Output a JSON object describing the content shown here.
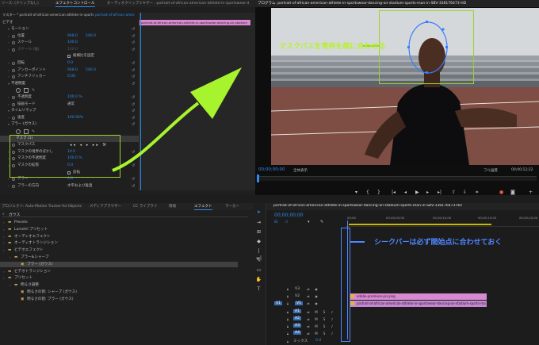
{
  "effect_controls": {
    "tabs": [
      "ソース: (クリップなし)",
      "エフェクトコントロール",
      "オーディオクリップミキサー : portrait-of-african-american-athlete-in-sportswear-d"
    ],
    "source_line": "マスター * portrait-of-african-american-athlete-in-sportswear-dancing-on-stadium",
    "sequence_line": "portrait-of-african-american-athle...",
    "clip_label": "portrait-of-african-american-athlete-in-sportswear-dancing-on-stadium",
    "section_video": "ビデオ",
    "rows": [
      {
        "label": "モーション",
        "type": "header"
      },
      {
        "label": "位置",
        "v1": "948.0",
        "v2": "540.0"
      },
      {
        "label": "スケール",
        "v1": "100.0"
      },
      {
        "label": "スケール (幅)",
        "v1": "100.0",
        "dim": true
      },
      {
        "label": "縦横比を固定",
        "type": "checkbox"
      },
      {
        "label": "回転",
        "v1": "0.0"
      },
      {
        "label": "アンカーポイント",
        "v1": "948.0",
        "v2": "540.0"
      },
      {
        "label": "アンチフリッカー",
        "v1": "0.00"
      },
      {
        "label": "不透明度",
        "type": "header"
      },
      {
        "label": "",
        "type": "mask-tools"
      },
      {
        "label": "不透明度",
        "v1": "100.0 %"
      },
      {
        "label": "描画モード",
        "v1": "通常",
        "plain": true
      },
      {
        "label": "タイムリマップ",
        "type": "header"
      },
      {
        "label": "速度",
        "v1": "100.00%"
      },
      {
        "label": "ブラー (ガウス)",
        "type": "header"
      },
      {
        "label": "",
        "type": "mask-tools"
      },
      {
        "label": "マスク (1)",
        "type": "subheader"
      },
      {
        "label": "マスクパス",
        "type": "maskpath"
      },
      {
        "label": "マスクの境界のぼかし",
        "v1": "10.0"
      },
      {
        "label": "マスクの不透明度",
        "v1": "100.0 %"
      },
      {
        "label": "マスクの拡張",
        "v1": "0.0"
      },
      {
        "label": "反転",
        "type": "checkbox"
      },
      {
        "label": "ブラー",
        "v1": "0.0"
      },
      {
        "label": "ブラーの方向",
        "v1": "水平および垂直",
        "plain": true
      }
    ]
  },
  "program_monitor": {
    "title": "プログラム: portrait-of-african-american-athlete-in-sportswear-dancing-on-stadium-sports-man-in-SBV-338176473-HD",
    "timecode": "00;00;00;00",
    "fit": "全体表示",
    "quality": "フル画質",
    "end_timecode": "00;00;12;22"
  },
  "timeline": {
    "title": "portrait-of-african-american-athlete-in-sportswear-dancing-on-stadium-sports-man-in-SBV-338176473-HD",
    "timecode": "00;00;00;00",
    "ruler": [
      "00;00",
      "00;00;05;00",
      "00;00;10;00",
      "00;00;15;00",
      "00;00;20;00"
    ],
    "video_tracks": [
      "V3",
      "V2",
      "V1"
    ],
    "audio_tracks": [
      "A1",
      "A2",
      "A3",
      "A4"
    ],
    "mix_label": "ミックス",
    "mix_value": "0.0",
    "clip_v2": "adobe-premiere-pro.png",
    "clip_v1": "portrait-of-african-american-athlete-in-sportswear-dancing-on-stadium-sports-man-in"
  },
  "project_panel": {
    "tabs": [
      "プロジェクト: Auto-Motion Tracker-for-Objects",
      "メディアブラウザー",
      "CC ライブラリ",
      "情報",
      "エフェクト",
      "マーカー"
    ],
    "search_value": "ガウス",
    "items": [
      {
        "label": "Presets",
        "indent": 0,
        "folder": true
      },
      {
        "label": "Lumetri プリセット",
        "indent": 0,
        "folder": true
      },
      {
        "label": "オーディオエフェクト",
        "indent": 0,
        "folder": true
      },
      {
        "label": "オーディオトランジション",
        "indent": 0,
        "folder": true
      },
      {
        "label": "ビデオエフェクト",
        "indent": 0,
        "folder": true
      },
      {
        "label": "ブラー&シャープ",
        "indent": 1,
        "folder": true
      },
      {
        "label": "ブラー (ガウス)",
        "indent": 2,
        "folder": false,
        "selected": true
      },
      {
        "label": "ビデオトランジション",
        "indent": 0,
        "folder": true
      },
      {
        "label": "プリセット",
        "indent": 0,
        "folder": true
      },
      {
        "label": "明るさ調整",
        "indent": 1,
        "folder": true
      },
      {
        "label": "明るさの割: シャープ (ガウス)",
        "indent": 2,
        "folder": false
      },
      {
        "label": "明るさの割: ブラー (ガウス)",
        "indent": 2,
        "folder": false
      }
    ]
  },
  "annotations": {
    "mask_note": "マスクパスを青枠を顔に合わせる",
    "seek_note": "シークバーは必ず開始点に合わせておく"
  },
  "colors": {
    "accent_blue": "#2d8ceb",
    "annotation_green": "#9bd22a",
    "annotation_blue": "#4f86ff",
    "clip_pink": "#d88ad0",
    "playhead": "#4f86ff"
  }
}
